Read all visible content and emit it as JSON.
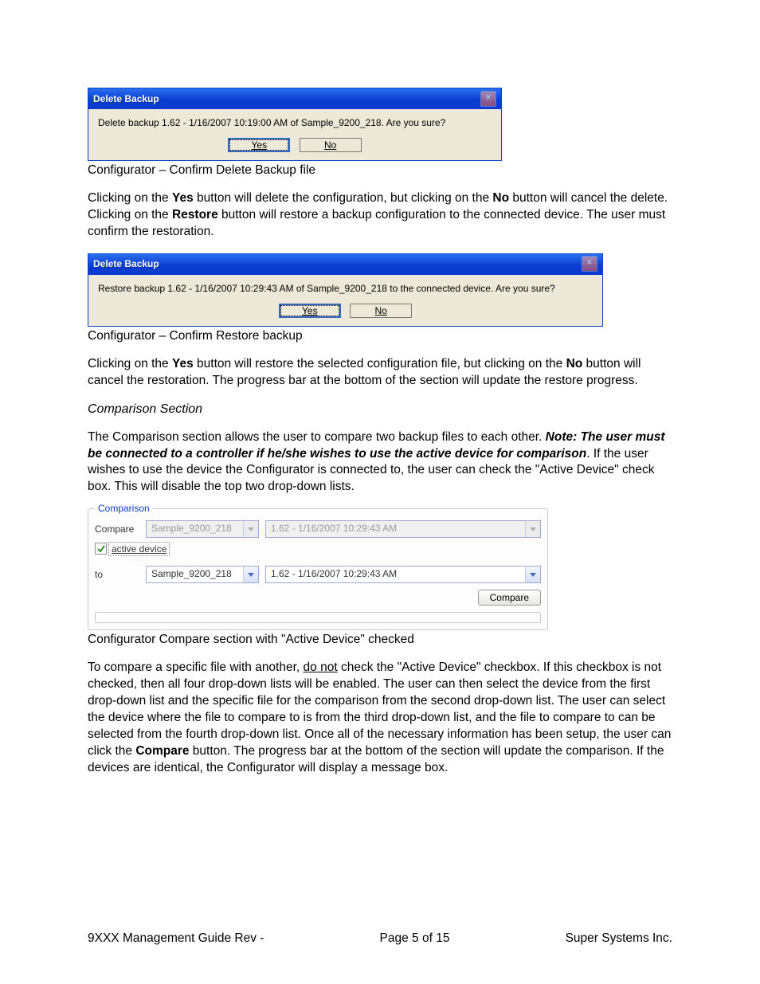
{
  "dialog1": {
    "title": "Delete Backup",
    "message": "Delete backup 1.62 - 1/16/2007 10:19:00 AM of Sample_9200_218.  Are you sure?",
    "yes": "Yes",
    "no": "No"
  },
  "caption1": "Configurator – Confirm Delete Backup file",
  "para1_a": "Clicking on the ",
  "para1_yes": "Yes",
  "para1_b": " button will delete the configuration, but clicking on the ",
  "para1_no": "No",
  "para1_c": " button will cancel the delete.",
  "para2_a": "Clicking on the ",
  "para2_restore": "Restore",
  "para2_b": " button will restore a backup configuration to the connected device.  The user must confirm the restoration.",
  "dialog2": {
    "title": "Delete Backup",
    "message": "Restore backup 1.62 - 1/16/2007 10:29:43 AM of Sample_9200_218 to the connected device.  Are you sure?",
    "yes": "Yes",
    "no": "No"
  },
  "caption2": "Configurator – Confirm Restore backup",
  "para3_a": "Clicking on the ",
  "para3_yes": "Yes",
  "para3_b": " button will restore the selected configuration file, but clicking on the ",
  "para3_no": "No",
  "para3_c": " button will cancel the restoration.  The progress bar at the bottom of the section will update the restore progress.",
  "section_heading": "Comparison Section",
  "para4_a": "The Comparison section allows the user to compare two backup files to each other.  ",
  "para4_note": "Note: The user must be connected to a controller if he/she wishes to use the active device for comparison",
  "para4_b": ".  If the user wishes to use the device the Configurator is connected to, the user can check the \"Active Device\" check box.  This will disable the top two drop-down lists.",
  "comparison": {
    "legend": "Comparison",
    "compare_label": "Compare",
    "to_label": "to",
    "active_device_label": "active device",
    "compare_btn": "Compare",
    "compare_device": "Sample_9200_218",
    "compare_file": "1.62 - 1/16/2007 10:29:43 AM",
    "to_device": "Sample_9200_218",
    "to_file": "1.62 - 1/16/2007 10:29:43 AM"
  },
  "caption3": "Configurator Compare section with \"Active Device\" checked",
  "para5_a": "To compare a specific file with another, ",
  "para5_donot": "do not",
  "para5_b": " check the \"Active Device\" checkbox.  If this checkbox is not checked, then all four drop-down lists will be enabled.  The user can then select the device from the first drop-down list and the specific file for the comparison from the second drop-down list.  The user can select the device where the file to compare to is from the third drop-down list, and the file to compare to can be selected from the fourth drop-down list.  Once all of the necessary information has been setup, the user can click the ",
  "para5_compare": "Compare",
  "para5_c": " button.  The progress bar at the bottom of the section will update the comparison.  If the devices are identical, the Configurator will display a message box.",
  "footer": {
    "left": "9XXX Management Guide Rev -",
    "center": "Page 5 of 15",
    "right": "Super Systems Inc."
  }
}
